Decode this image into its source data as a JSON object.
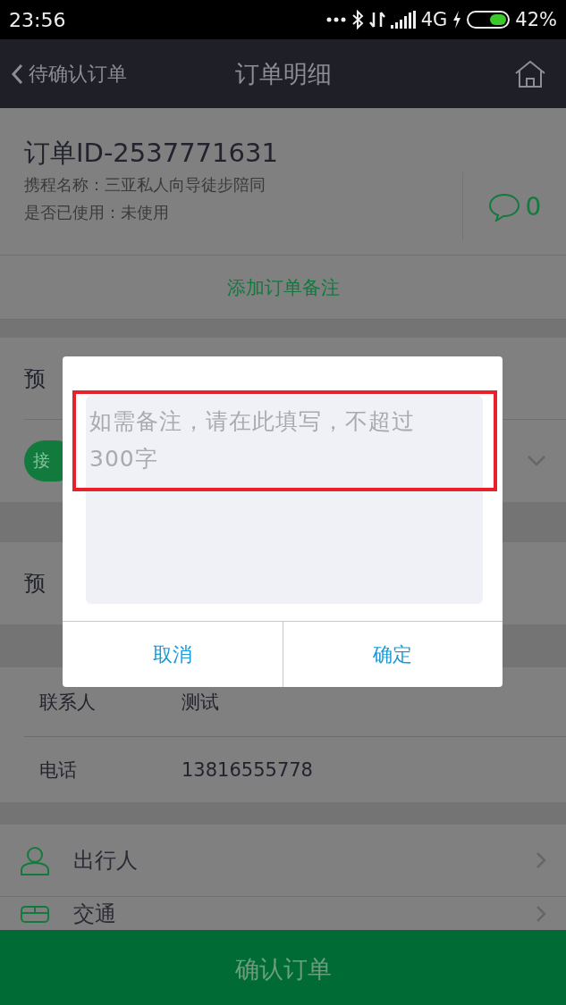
{
  "status_bar": {
    "time": "23:56",
    "network": "4G",
    "battery": "42%"
  },
  "header": {
    "back_label": "待确认订单",
    "title": "订单明细"
  },
  "order": {
    "id": "订单ID-2537771631",
    "trip_name": "携程名称：三亚私人向导徒步陪同",
    "used_status": "是否已使用：未使用",
    "comment_count": "0"
  },
  "add_note_button": "添加订单备注",
  "booking_section": {
    "title": "预",
    "tag": "接"
  },
  "scheduled_section": {
    "title": "预"
  },
  "contacts": [
    {
      "label": "联系人",
      "value": "测试"
    },
    {
      "label": "电话",
      "value": "13816555778"
    }
  ],
  "menu_items": [
    {
      "kind": "traveler",
      "label": "出行人"
    },
    {
      "kind": "transport",
      "label": "交通"
    }
  ],
  "dialog": {
    "placeholder": "如需备注，请在此填写，不超过300字",
    "buttons": [
      "取消",
      "确定"
    ]
  },
  "confirm_button": "确认订单"
}
